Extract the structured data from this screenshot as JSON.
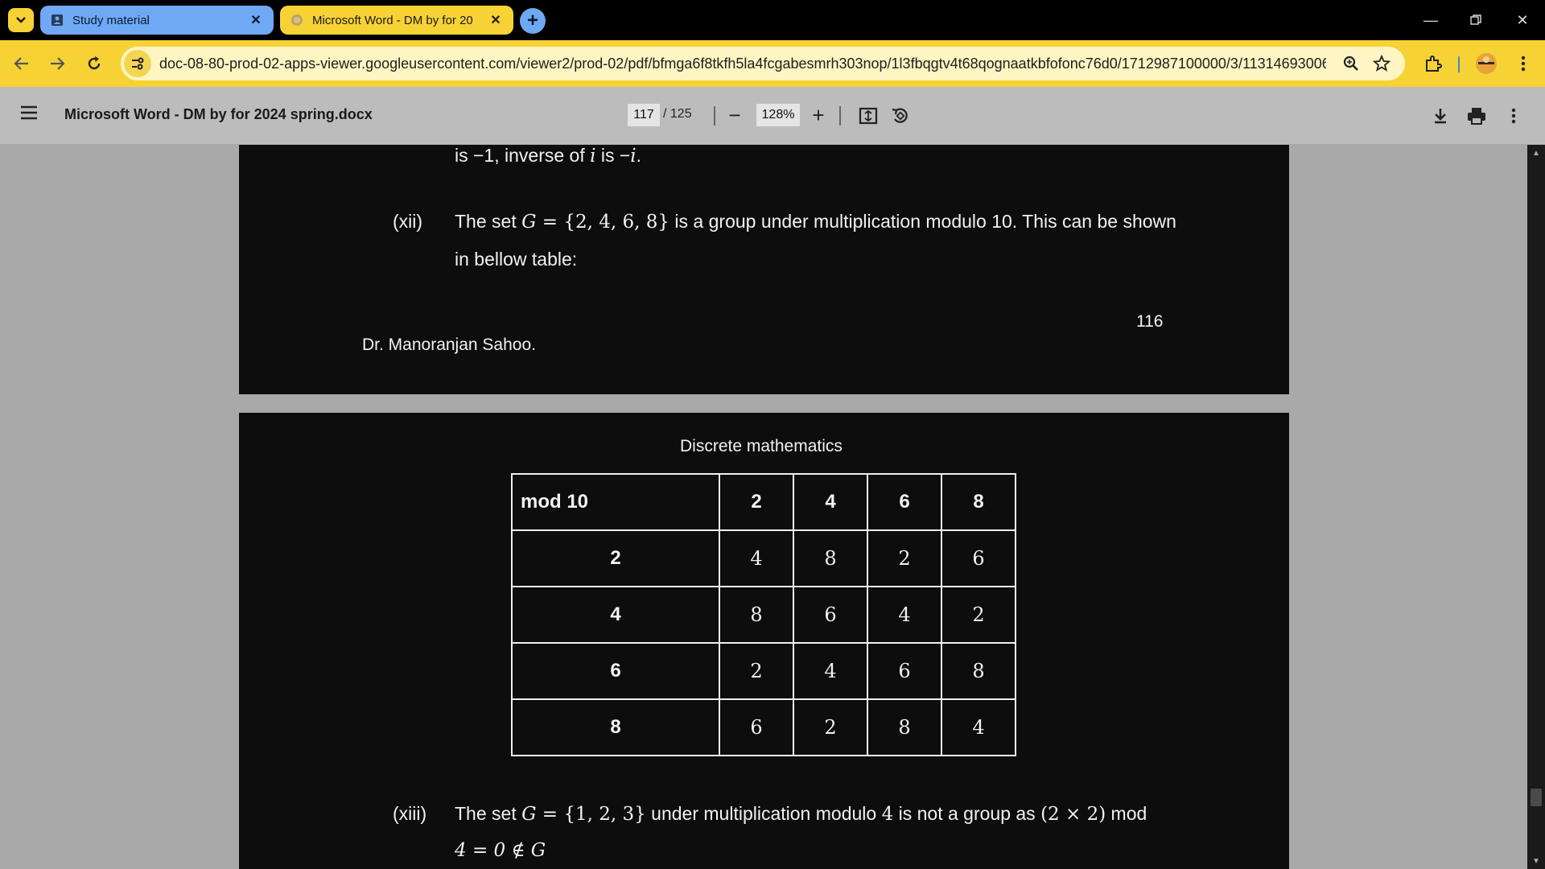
{
  "tabs": [
    {
      "title": "Study material"
    },
    {
      "title": "Microsoft Word - DM by for 20"
    }
  ],
  "address_bar": {
    "url": "doc-08-80-prod-02-apps-viewer.googleusercontent.com/viewer2/prod-02/pdf/bfmga6f8tkfh5la4fcgabesmrh303nop/1l3fbqgtv4t68qognaatkbfofonc76d0/1712987100000/3/11314693006..."
  },
  "pdf_viewer": {
    "doc_title": "Microsoft Word - DM by for 2024 spring.docx",
    "current_page": "117",
    "total_pages": "/ 125",
    "zoom": "128%"
  },
  "page1": {
    "line_top_a": "is −1, inverse of ",
    "line_top_i": "i",
    "line_top_b": " is −",
    "line_top_i2": "i",
    "line_top_c": ".",
    "item_xii_label": "(xii)",
    "item_xii_a": "The set ",
    "item_xii_G": "G",
    "item_xii_set": " = {2, 4, 6, 8}",
    "item_xii_b": " is a group under multiplication modulo 10. This can be shown",
    "item_xii_line2": "in bellow table:",
    "page_number": "116",
    "footer_author": "Dr. Manoranjan Sahoo."
  },
  "page2": {
    "header": "Discrete mathematics",
    "table": {
      "corner": "mod 10",
      "col_headers": [
        "2",
        "4",
        "6",
        "8"
      ],
      "rows": [
        {
          "head": "2",
          "cells": [
            "4",
            "8",
            "2",
            "6"
          ]
        },
        {
          "head": "4",
          "cells": [
            "8",
            "6",
            "4",
            "2"
          ]
        },
        {
          "head": "6",
          "cells": [
            "2",
            "4",
            "6",
            "8"
          ]
        },
        {
          "head": "8",
          "cells": [
            "6",
            "2",
            "8",
            "4"
          ]
        }
      ]
    },
    "item_xiii_label": "(xiii)",
    "item_xiii_a": "The set ",
    "item_xiii_G": "G",
    "item_xiii_set": " = {1, 2, 3}",
    "item_xiii_b": " under multiplication modulo ",
    "item_xiii_4": "4",
    "item_xiii_c": "  is not a group as ",
    "item_xiii_expr": "(2 × 2)",
    "item_xiii_d": " mod",
    "item_xiii_line2": "4 = 0 ∉ G"
  },
  "colors": {
    "accent_yellow": "#f6d235",
    "tab_blue": "#6fa8f3",
    "viewer_bg": "#a9a9a9",
    "page_bg": "#0d0d0d"
  }
}
